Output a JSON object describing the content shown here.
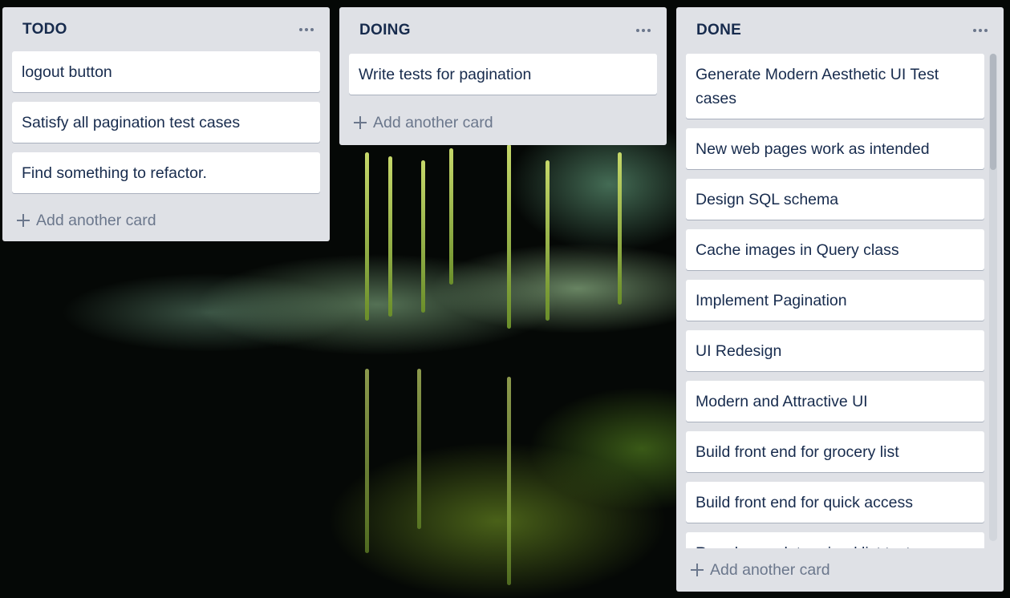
{
  "board": {
    "add_card_label": "Add another card",
    "lists": [
      {
        "title": "TODO",
        "cards": [
          "logout button",
          "Satisfy all pagination test cases",
          "Find something to refactor."
        ]
      },
      {
        "title": "DOING",
        "cards": [
          "Write tests for pagination"
        ]
      },
      {
        "title": "DONE",
        "cards": [
          "Generate Modern Aesthetic UI Test cases",
          "New web pages work as intended",
          "Design SQL schema",
          "Cache images in Query class",
          "Implement Pagination",
          "UI Redesign",
          "Modern and Attractive UI",
          "Build front end for grocery list",
          "Build front end for quick access",
          "Reorder predetermined list test"
        ]
      }
    ]
  },
  "icons": {
    "list_menu": "more-horizontal-icon",
    "add": "plus-icon"
  },
  "colors": {
    "list_background": "#dfe1e6",
    "card_background": "#ffffff",
    "title_text": "#172b4d",
    "muted_text": "#6b778c"
  }
}
